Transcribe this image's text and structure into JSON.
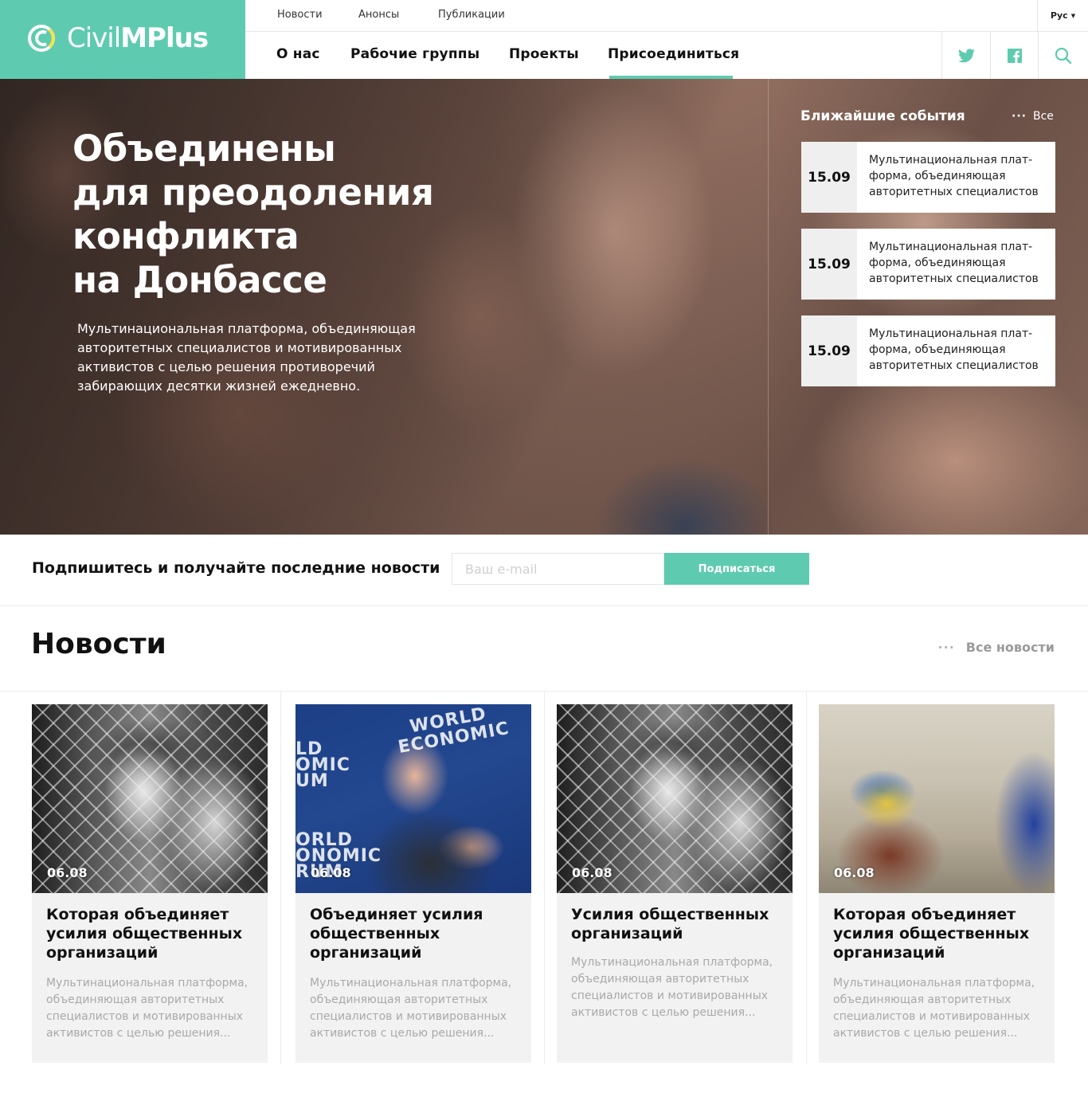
{
  "header": {
    "logo": {
      "text_light": "Civil",
      "text_bold": "MPlus"
    },
    "top_links": [
      "Новости",
      "Анонсы",
      "Публикации"
    ],
    "language": "Рус",
    "main_nav": [
      "О нас",
      "Рабочие группы",
      "Проекты",
      "Присоединиться"
    ],
    "active_nav": "Присоединиться",
    "social_icons": [
      "twitter-icon",
      "facebook-icon",
      "search-icon"
    ]
  },
  "hero": {
    "title_lines": [
      "Объединены",
      "для преодоления",
      "конфликта",
      "на Донбассе"
    ],
    "subtitle_lines": [
      "Мультинациональная платформа, объединяющая",
      "авторитетных специалистов и мотивированных",
      "активистов с целью решения противоречий",
      "забирающих десятки жизней ежедневно."
    ],
    "events_heading": "Ближайшие события",
    "events_all": "Все",
    "events": [
      {
        "date": "15.09",
        "lines": [
          "Мультинациональная плат-",
          "форма, объединяющая",
          "авторитетных специалистов"
        ]
      },
      {
        "date": "15.09",
        "lines": [
          "Мультинациональная плат-",
          "форма, объединяющая",
          "авторитетных специалистов"
        ]
      },
      {
        "date": "15.09",
        "lines": [
          "Мультинациональная плат-",
          "форма, объединяющая",
          "авторитетных специалистов"
        ]
      }
    ]
  },
  "subscribe": {
    "label": "Подпишитесь и получайте последние новости",
    "placeholder": "Ваш e-mail",
    "value": "",
    "button": "Подписаться"
  },
  "news": {
    "heading": "Новости",
    "all_link": "Все новости",
    "wef_text": [
      "WORLD",
      "ECONOMIC",
      "LD",
      "OMIC",
      "UM",
      "ORLD",
      "ONOMIC",
      "RUM"
    ],
    "items": [
      {
        "date": "06.08",
        "title_lines": [
          "Которая объединяет",
          "усилия общественных",
          "организаций"
        ],
        "text_lines": [
          "Мультинациональная платформа,",
          "объединяющая авторитетных",
          "специалистов и мотивированных",
          "активистов с целью решения..."
        ]
      },
      {
        "date": "06.08",
        "title_lines": [
          "Объединяет усилия",
          "общественных",
          "организаций"
        ],
        "text_lines": [
          "Мультинациональная платформа,",
          "объединяющая авторитетных",
          "специалистов и мотивированных",
          "активистов с целью решения..."
        ]
      },
      {
        "date": "06.08",
        "title_lines": [
          "Усилия общественных",
          "организаций"
        ],
        "text_lines": [
          "Мультинациональная платформа,",
          "объединяющая авторитетных",
          "специалистов и мотивированных",
          "активистов с целью решения..."
        ]
      },
      {
        "date": "06.08",
        "title_lines": [
          "Которая объединяет",
          "усилия общественных",
          "организаций"
        ],
        "text_lines": [
          "Мультинациональная платформа,",
          "объединяющая авторитетных",
          "специалистов и мотивированных",
          "активистов с целью решения..."
        ]
      }
    ]
  },
  "colors": {
    "accent": "#5ecbb0",
    "card_bg": "#f2f2f2",
    "muted_text": "#a9a9a9"
  }
}
